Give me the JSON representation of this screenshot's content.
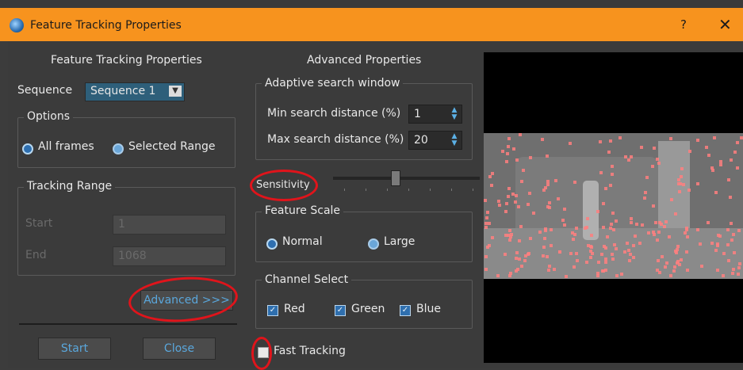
{
  "window": {
    "title": "Feature Tracking Properties",
    "help": "?",
    "close": "✕"
  },
  "left": {
    "header": "Feature Tracking Properties",
    "sequence_label": "Sequence",
    "sequence_value": "Sequence 1",
    "options_legend": "Options",
    "all_frames": "All frames",
    "selected_range": "Selected Range",
    "tracking_range_legend": "Tracking Range",
    "start_label": "Start",
    "start_value": "1",
    "end_label": "End",
    "end_value": "1068",
    "advanced_button": "Advanced >>>",
    "start_button": "Start",
    "close_button": "Close"
  },
  "advanced": {
    "header": "Advanced Properties",
    "adaptive_legend": "Adaptive search window",
    "min_label": "Min search distance (%)",
    "min_value": "1",
    "max_label": "Max search distance (%)",
    "max_value": "20",
    "sensitivity_label": "Sensitivity",
    "feature_scale_legend": "Feature Scale",
    "normal": "Normal",
    "large": "Large",
    "channel_legend": "Channel Select",
    "red": "Red",
    "green": "Green",
    "blue": "Blue",
    "fast_tracking": "Fast Tracking"
  },
  "colors": {
    "titlebar": "#f7931e",
    "annotation": "#e0141b",
    "features": "#ff7f7f"
  }
}
